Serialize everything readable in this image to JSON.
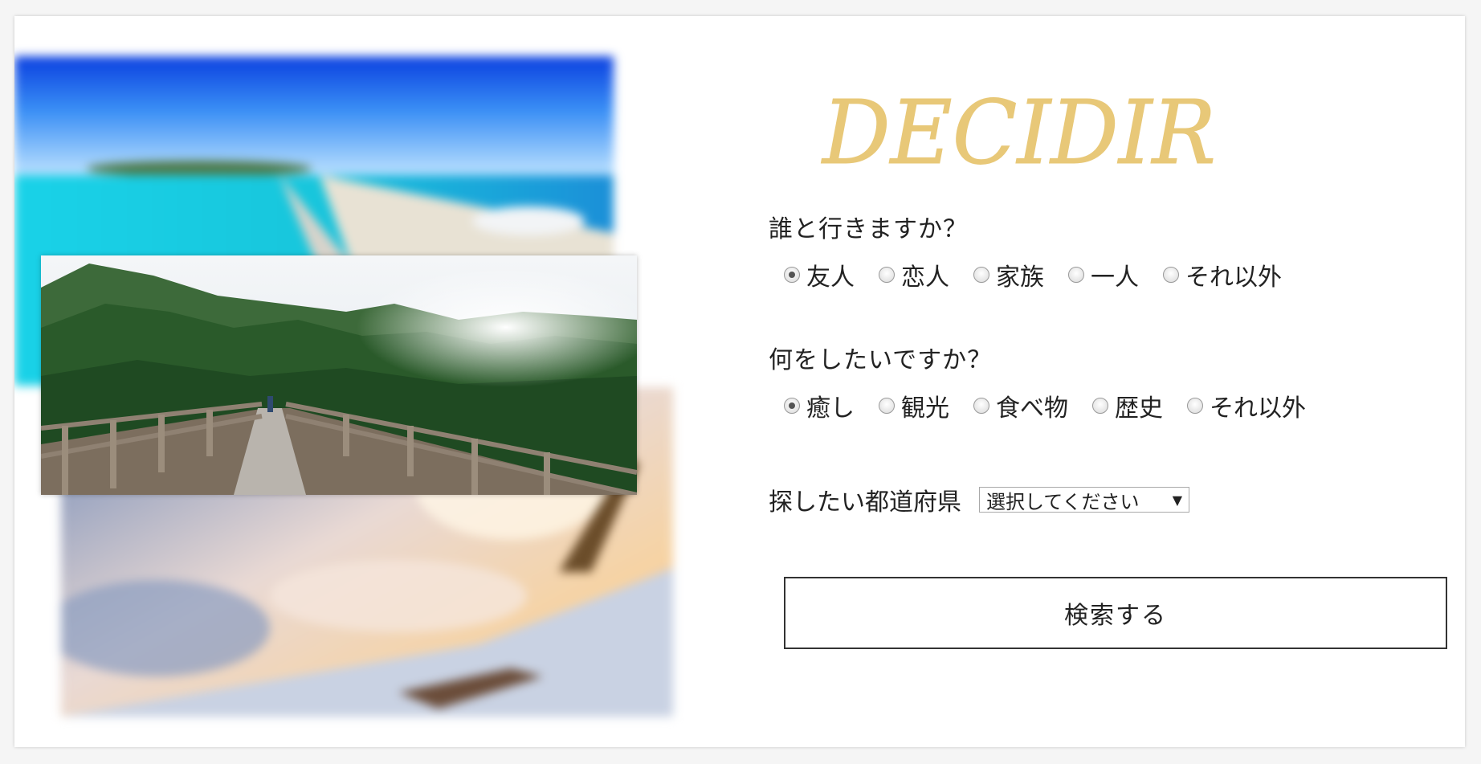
{
  "brand": {
    "logo_text": "DECIDIR",
    "logo_color": "#e8c878"
  },
  "companion": {
    "question": "誰と行きますか？",
    "options": [
      "友人",
      "恋人",
      "家族",
      "一人",
      "それ以外"
    ],
    "selected_index": 0
  },
  "activity": {
    "question": "何をしたいですか？",
    "options": [
      "癒し",
      "観光",
      "食べ物",
      "歴史",
      "それ以外"
    ],
    "selected_index": 0
  },
  "prefecture": {
    "label": "探したい都道府県",
    "selected": "選択してください"
  },
  "search_button": {
    "label": "検索する"
  },
  "collage": {
    "images": [
      "beach-photo",
      "forest-bridge-photo",
      "airplane-sky-photo"
    ]
  }
}
